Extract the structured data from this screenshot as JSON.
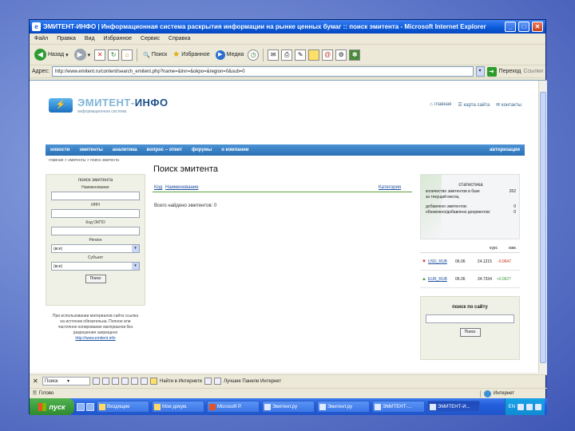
{
  "window": {
    "title": "ЭМИТЕНТ-ИНФО | Информационная система раскрытия информации на рынке ценных бумаг :: поиск эмитента - Microsoft Internet Explorer"
  },
  "menubar": {
    "items": [
      "Файл",
      "Правка",
      "Вид",
      "Избранное",
      "Сервис",
      "Справка"
    ]
  },
  "toolbar": {
    "back_label": "Назад",
    "search_label": "Поиск",
    "favorites_label": "Избранное",
    "media_label": "Медиа"
  },
  "addressbar": {
    "label": "Адрес:",
    "url": "http://www.emitent.ru/content/search_emitent.php?name=&inn=&okpo=&region=0&sub=0",
    "go_label": "Переход",
    "links_label": "Ссылки"
  },
  "site": {
    "logo_text_light": "ЭМИТЕНТ-",
    "logo_text_bold": "ИНФО",
    "logo_subtitle": "информационная система",
    "toplinks": [
      "главная",
      "карта сайта",
      "контакты"
    ],
    "nav": [
      "новости",
      "эмитенты",
      "аналитика",
      "вопрос – ответ",
      "форумы",
      "о компании"
    ],
    "nav_auth": "авторизация",
    "breadcrumb": "главная > эмитенты > поиск эмитента",
    "left_search": {
      "title": "поиск эмитента",
      "name_label": "Наименование",
      "inn_label": "ИНН",
      "okpo_label": "Код ОКПО",
      "region_label": "Регион",
      "region_value": "(все)",
      "subject_label": "Субъект",
      "subject_value": "(все)",
      "button": "Поиск"
    },
    "left_note": "При использовании материалов сайта ссылка на источник обязательна. Полное или частичное копирование материалов без разрешения запрещено",
    "left_note_link": "http://www.emitent.info",
    "main": {
      "title": "Поиск эмитента",
      "col_code": "Код",
      "col_name": "Наименование",
      "col_category": "Категория",
      "found_text": "Всего найдено эмитентов: 0"
    },
    "stats": {
      "title": "статистика",
      "rows": [
        {
          "label": "количество эмитентов в базе",
          "value": "262"
        },
        {
          "label": "за текущий месяц",
          "value": ""
        },
        {
          "label": "добавлено эмитентов:",
          "value": "0"
        },
        {
          "label": "обновлено/добавлено документов:",
          "value": "0"
        }
      ]
    },
    "fx": {
      "header_rate": "курс",
      "header_change": "изм.",
      "rows": [
        {
          "direction": "down",
          "pair": "USD_RUB",
          "date": "06.06",
          "rate": "24.1215",
          "change": "-0.0647"
        },
        {
          "direction": "up",
          "pair": "EUR_RUB",
          "date": "06.06",
          "rate": "34.7334",
          "change": "+0.0627"
        }
      ]
    },
    "site_search": {
      "title": "поиск по сайту",
      "button": "Поиск"
    }
  },
  "linksbar": {
    "dropdown": "Поиск",
    "links": "Найти в Интернете",
    "extra": "Лучшие Панели Интернет"
  },
  "statusbar": {
    "left": "Готово",
    "zone": "Интернет"
  },
  "taskbar": {
    "start": "пуск",
    "tasks": [
      "Входящие",
      "Мои докум.",
      "Microsoft P.",
      "Эмитент.ру",
      "Эмитент.ру",
      "ЭМИТЕНТ-...",
      "ЭМИТЕНТ-И..."
    ],
    "active_index": 6,
    "tray_lang": "EN"
  }
}
